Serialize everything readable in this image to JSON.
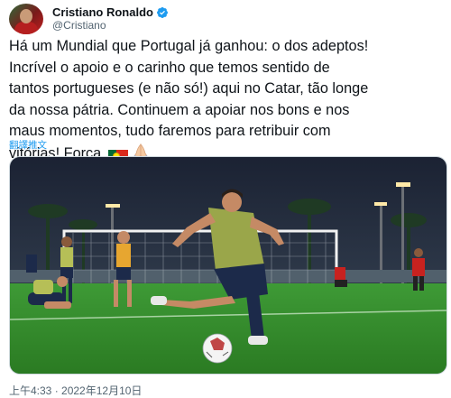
{
  "author": {
    "display_name": "Cristiano Ronaldo",
    "handle": "@Cristiano",
    "verified": true
  },
  "tweet": {
    "lines": [
      "Há um Mundial que Portugal já ganhou: o dos adeptos!",
      "Incrível o apoio e o carinho que temos sentido de",
      "tantos portugueses (e não só!) aqui no Catar, tão longe",
      "da nossa pátria. Continuem a apoiar nos bons e nos",
      "maus momentos, tudo faremos para retribuir com",
      "vitórias! Força,"
    ],
    "emojis": [
      "portugal-flag",
      "folded-hands"
    ],
    "translate_label": "翻譯推文",
    "timestamp": "上午4:33 · 2022年12月10日"
  },
  "colors": {
    "link": "#1d9bf0",
    "verified": "#1d9bf0",
    "muted": "#536471",
    "jersey": "#9aa64a",
    "shorts": "#1c2a4a",
    "pitch": "#2f8a2a"
  }
}
